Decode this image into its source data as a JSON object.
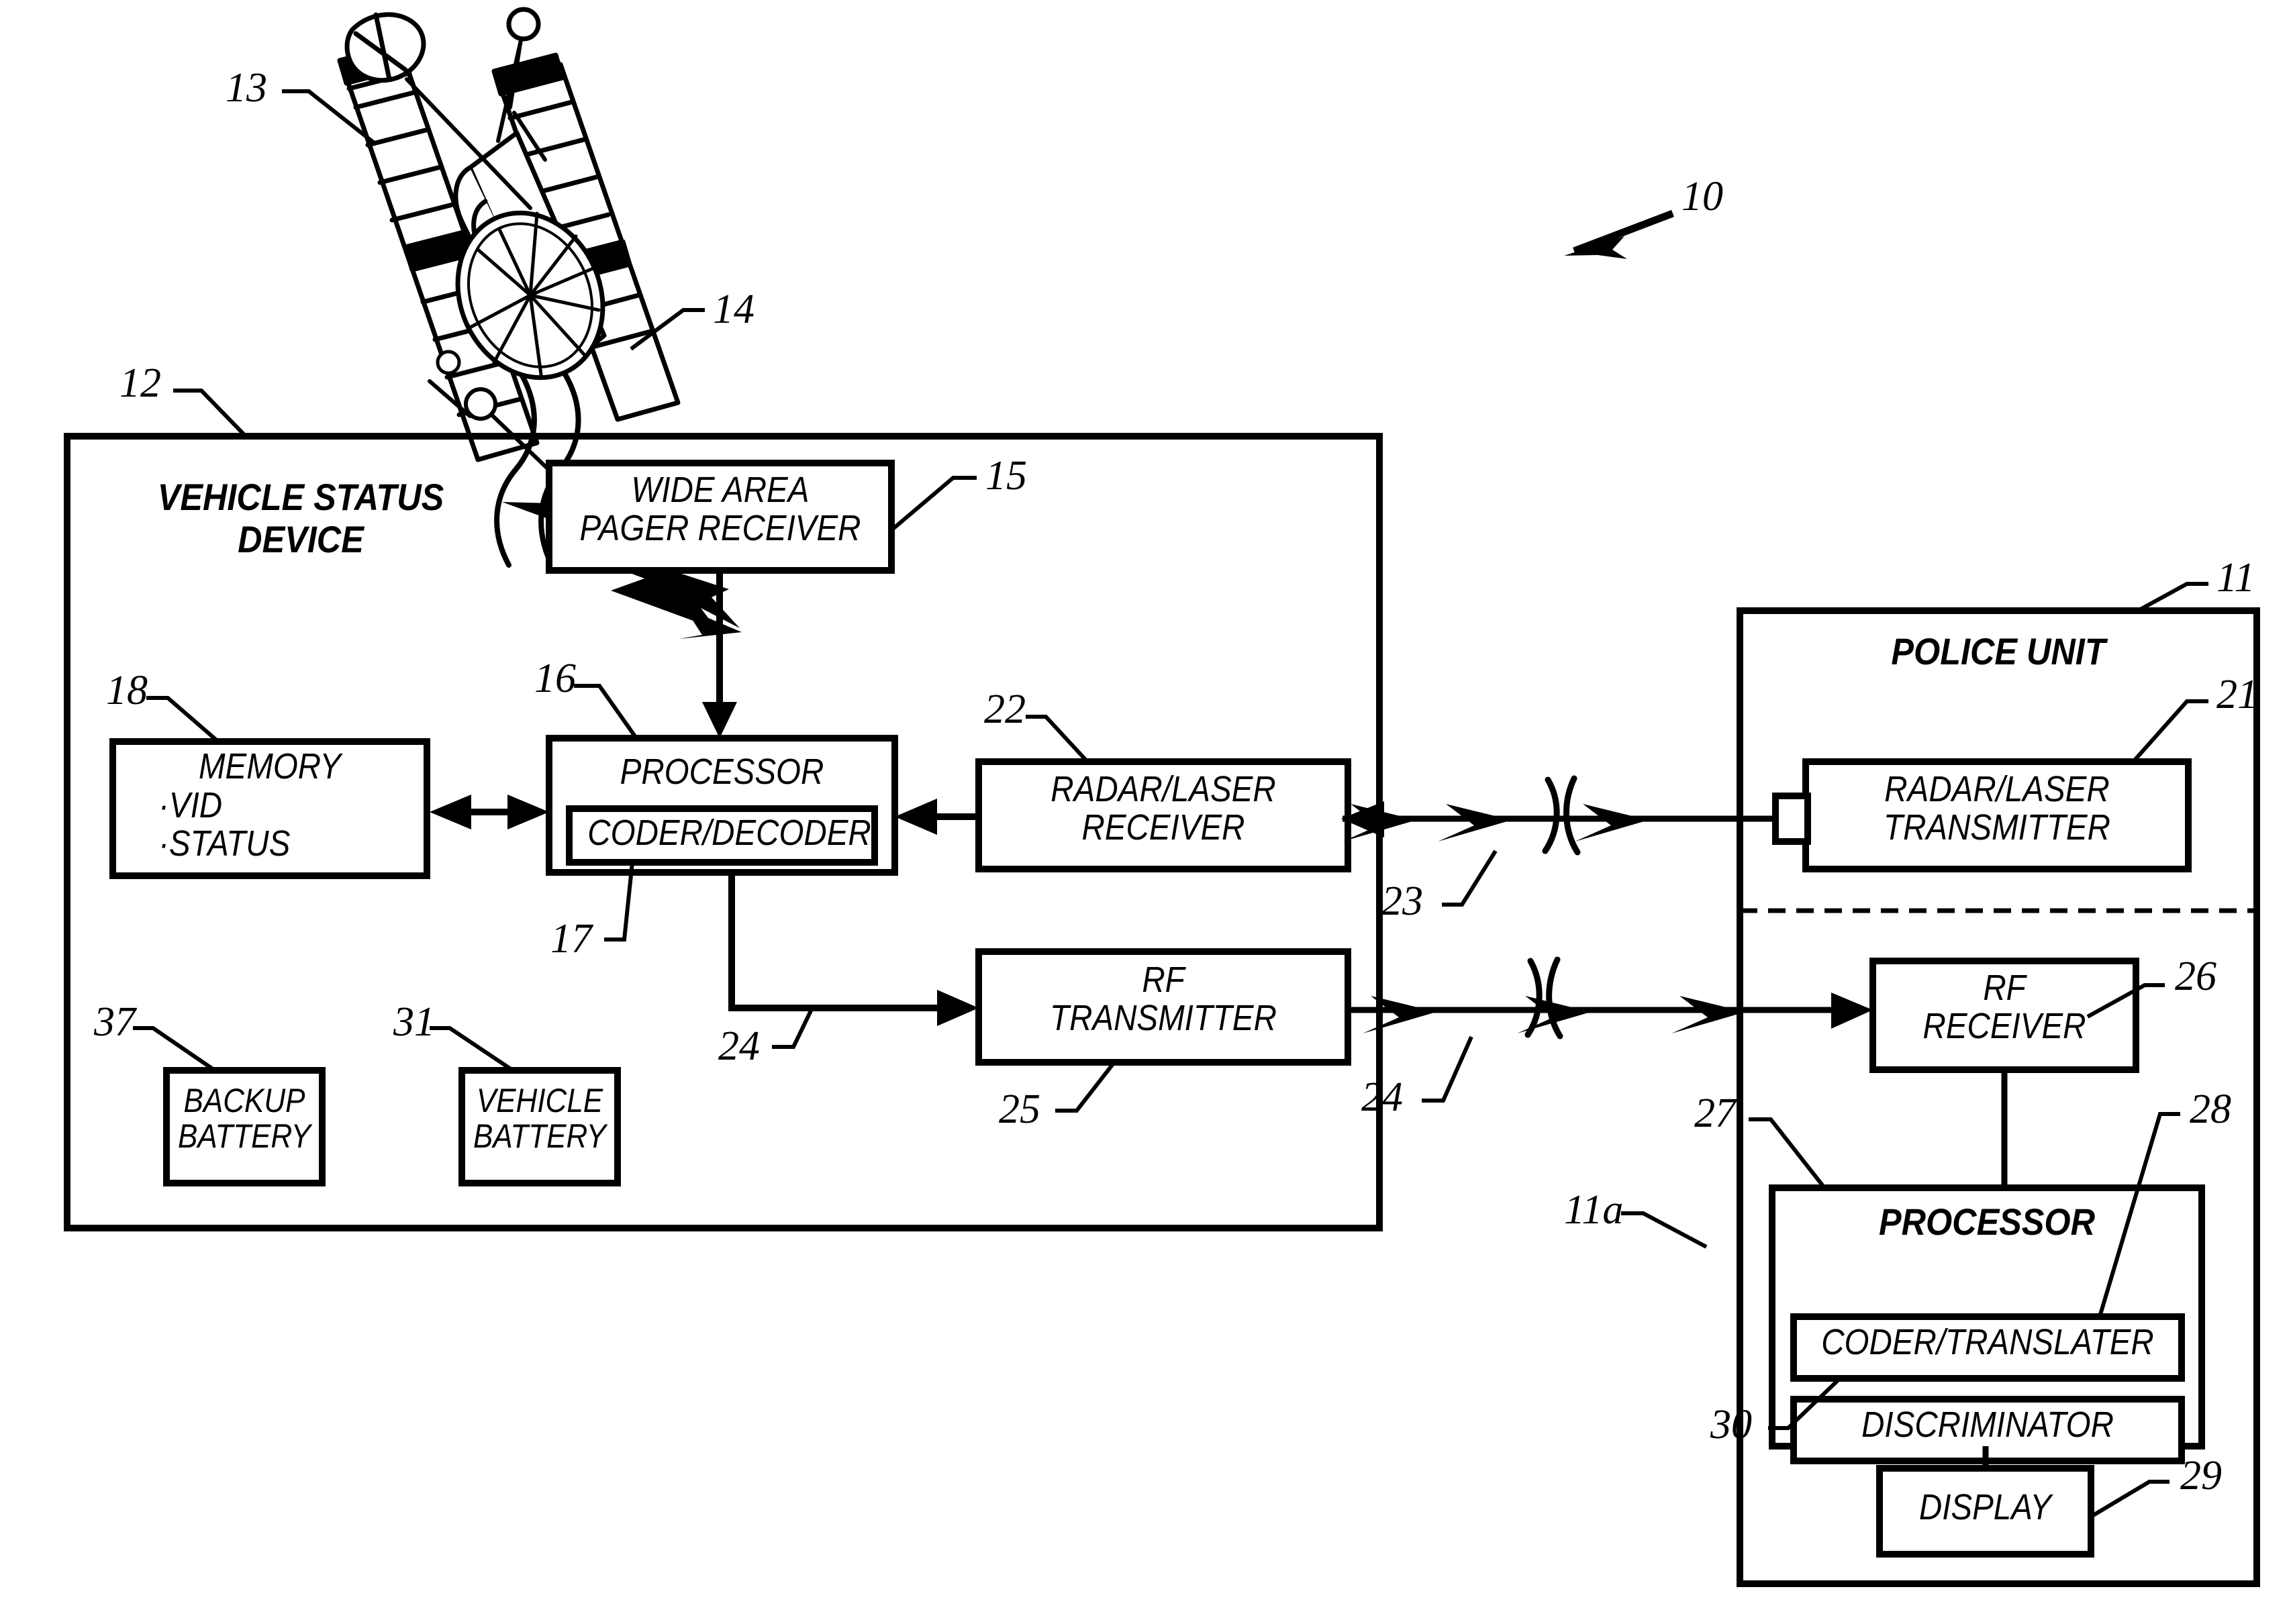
{
  "figure": {
    "system_ref": "10",
    "satellite_ref": "13",
    "satellite_link_ref": "14"
  },
  "vehicle_status_device": {
    "ref": "12",
    "title": "VEHICLE STATUS\nDEVICE",
    "blocks": {
      "pager_receiver": {
        "ref": "15",
        "label": "WIDE AREA\nPAGER RECEIVER"
      },
      "memory": {
        "ref": "18",
        "label": "MEMORY",
        "items": "·VID\n·STATUS"
      },
      "processor": {
        "ref": "16",
        "label": "PROCESSOR"
      },
      "coder_decoder": {
        "ref": "17",
        "label": "CODER/DECODER"
      },
      "radar_laser_receiver": {
        "ref": "22",
        "label": "RADAR/LASER\nRECEIVER"
      },
      "rf_transmitter": {
        "ref": "25",
        "label": "RF\nTRANSMITTER"
      },
      "backup_battery": {
        "ref": "37",
        "label": "BACKUP\nBATTERY"
      },
      "vehicle_battery": {
        "ref": "31",
        "label": "VEHICLE\nBATTERY"
      }
    },
    "signal_path_ref": "24"
  },
  "police_unit": {
    "ref": "11",
    "sub_ref": "11a",
    "title": "POLICE UNIT",
    "blocks": {
      "radar_laser_transmitter": {
        "ref": "21",
        "label": "RADAR/LASER\nTRANSMITTER"
      },
      "rf_receiver": {
        "ref": "26",
        "label": "RF\nRECEIVER"
      },
      "processor": {
        "ref": "27",
        "label": "PROCESSOR"
      },
      "coder_translater": {
        "ref": "28",
        "label": "CODER/TRANSLATER"
      },
      "discriminator": {
        "ref": "30",
        "label": "DISCRIMINATOR"
      },
      "display": {
        "ref": "29",
        "label": "DISPLAY"
      }
    }
  },
  "links": {
    "radar_link_ref": "23",
    "rf_link_ref": "24"
  }
}
